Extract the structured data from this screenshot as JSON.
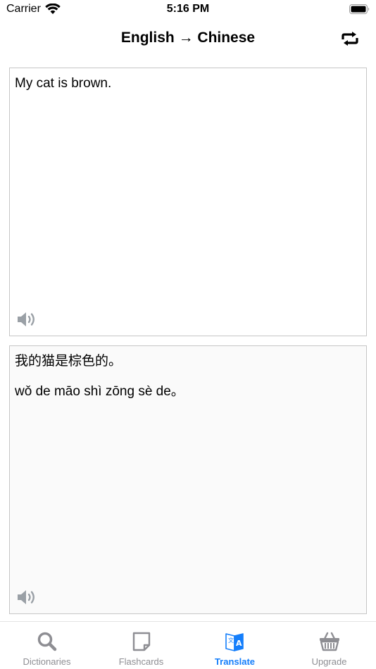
{
  "status_bar": {
    "carrier": "Carrier",
    "time": "5:16 PM"
  },
  "nav": {
    "title": "English → Chinese",
    "swap_icon": "swap-arrows-icon"
  },
  "source_panel": {
    "text": "My cat is brown.",
    "speaker_icon": "speaker-icon"
  },
  "target_panel": {
    "hanzi": "我的猫是棕色的。",
    "pinyin": "wǒ de māo shì zōng sè de。",
    "speaker_icon": "speaker-icon"
  },
  "tabs": [
    {
      "label": "Dictionaries",
      "icon": "search-icon",
      "active": false
    },
    {
      "label": "Flashcards",
      "icon": "flashcard-icon",
      "active": false
    },
    {
      "label": "Translate",
      "icon": "translate-icon",
      "active": true
    },
    {
      "label": "Upgrade",
      "icon": "basket-icon",
      "active": false
    }
  ],
  "colors": {
    "accent": "#147efb",
    "inactive_tab": "#8e8e93",
    "icon_gray": "#9aa0a6"
  }
}
